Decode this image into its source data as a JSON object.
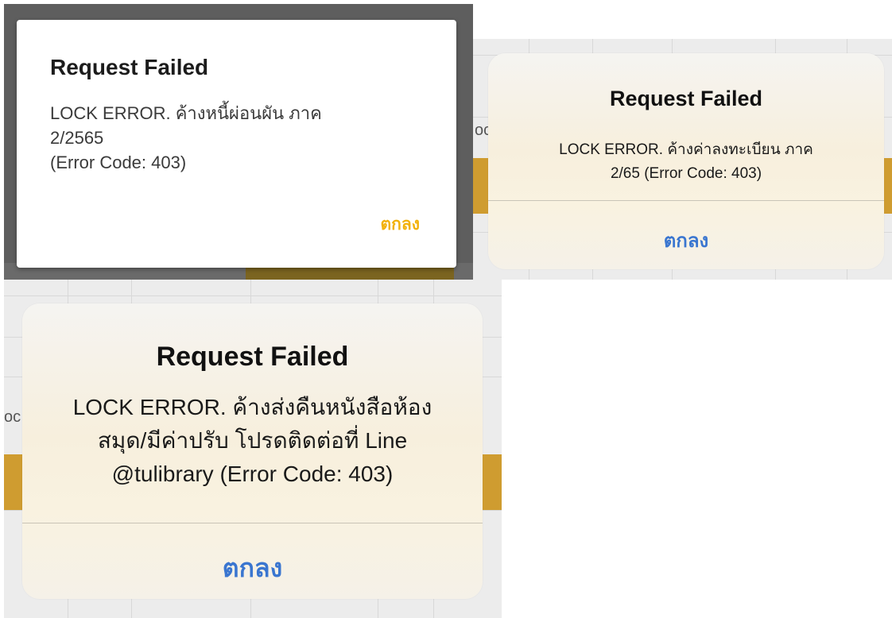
{
  "dialogs": [
    {
      "style": "android",
      "title": "Request Failed",
      "message": "LOCK ERROR. ค้างหนี้ผ่อนผัน ภาค\n2/2565\n(Error Code: 403)",
      "ok_label": "ตกลง",
      "accent_color": "#f2b10a"
    },
    {
      "style": "ios",
      "title": "Request Failed",
      "message": "LOCK ERROR. ค้างค่าลงทะเบียน ภาค\n2/65 (Error Code: 403)",
      "ok_label": "ตกลง",
      "accent_color": "#3a76d0"
    },
    {
      "style": "ios",
      "title": "Request Failed",
      "message": "LOCK ERROR. ค้างส่งคืนหนังสือห้อง\nสมุด/มีค่าปรับ โปรดติดต่อที่ Line\n@tulibrary (Error Code: 403)",
      "ok_label": "ตกลง",
      "accent_color": "#3a76d0"
    }
  ],
  "background_peek": {
    "p2_left_text": "oc",
    "p3_left_text": "oc"
  }
}
